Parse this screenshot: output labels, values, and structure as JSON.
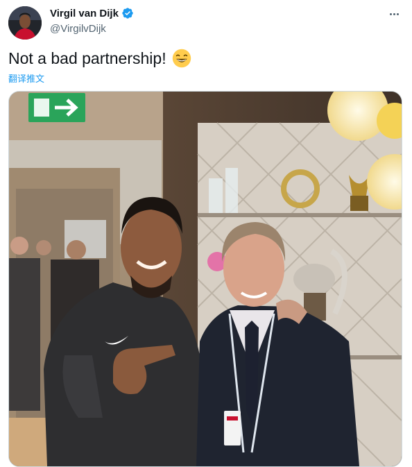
{
  "author": {
    "display_name": "Virgil van Dijk",
    "handle": "@VirgilvDijk",
    "verified": true
  },
  "tweet": {
    "text": "Not a bad partnership!",
    "emoji": "grinning-face-with-smiling-eyes",
    "translate_label": "翻译推文"
  },
  "icons": {
    "more": "more-horizontal-icon",
    "verified": "verified-badge-icon"
  },
  "colors": {
    "link": "#1d9bf0",
    "verified": "#1d9bf0",
    "secondary_text": "#536471",
    "exit_sign": "#2aa45a"
  }
}
